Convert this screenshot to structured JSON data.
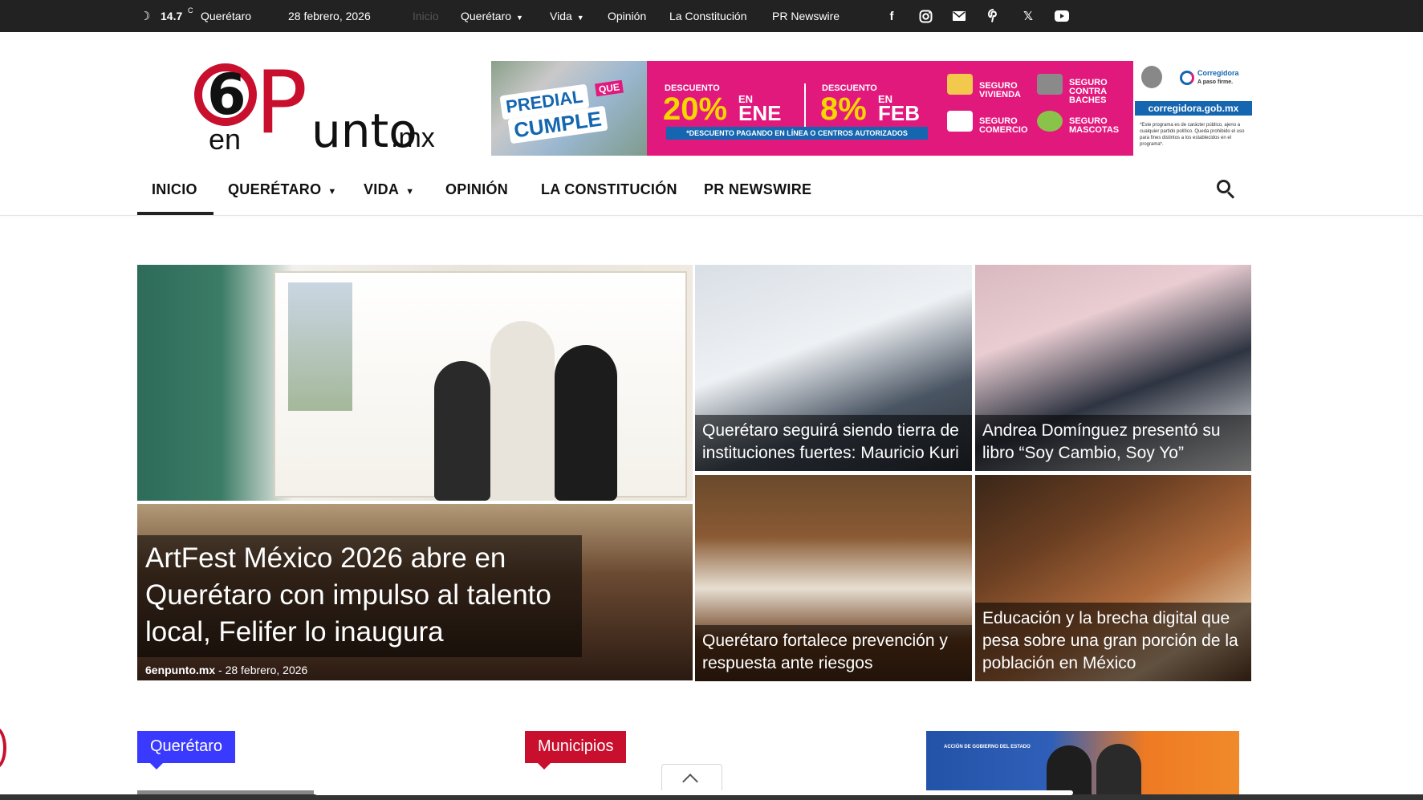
{
  "topbar": {
    "temperature": "14.7",
    "unit": "C",
    "city": "Querétaro",
    "date": "28 febrero, 2026",
    "nav": {
      "home": "Inicio",
      "queretaro": "Querétaro",
      "vida": "Vida",
      "opinion": "Opinión",
      "constitucion": "La Constitución",
      "prnewswire": "PR Newswire"
    },
    "social": [
      "facebook-icon",
      "instagram-icon",
      "mail-icon",
      "pinterest-icon",
      "x-icon",
      "youtube-icon"
    ]
  },
  "logo": {
    "six": "6",
    "en": "en",
    "p": "P",
    "unto": "unto",
    "mx": ".mx"
  },
  "banner": {
    "predial": "PREDIAL",
    "que": "QUE",
    "cumple": "CUMPLE",
    "descuento_label": "DESCUENTO",
    "ene_pct": "20%",
    "ene_en": "EN",
    "ene_month": "ENE",
    "feb_pct": "8%",
    "feb_en": "EN",
    "feb_month": "FEB",
    "strip": "*DESCUENTO PAGANDO EN LÍNEA O CENTROS AUTORIZADOS",
    "seguro_vivienda": "SEGURO VIVIENDA",
    "seguro_baches": "SEGURO CONTRA BACHES",
    "seguro_comercio": "SEGURO COMERCIO",
    "seguro_mascotas": "SEGURO MASCOTAS",
    "corregidora": "Corregidora",
    "corregidora_tag": "A paso firme.",
    "url": "corregidora.gob.mx",
    "note": "*Este programa es de carácter público, ajeno a cualquier partido político. Queda prohibido el uso para fines distintos a los establecidos en el programa*."
  },
  "mainnav": {
    "items": [
      "INICIO",
      "QUERÉTARO",
      "VIDA",
      "OPINIÓN",
      "LA CONSTITUCIÓN",
      "PR NEWSWIRE"
    ]
  },
  "featured": {
    "main": {
      "title": "ArtFest México 2026 abre en Querétaro con impulso al talento local, Felifer lo inaugura",
      "author": "6enpunto.mx",
      "separator": "-",
      "date": "28 febrero, 2026"
    },
    "tiles": [
      {
        "title": "Querétaro seguirá siendo tierra de instituciones fuertes: Mauricio Kuri"
      },
      {
        "title": "Andrea Domínguez presentó su libro “Soy Cambio, Soy Yo”"
      },
      {
        "title": "Querétaro fortalece prevención y respuesta ante riesgos"
      },
      {
        "title": "Educación y la brecha digital que pesa sobre una gran porción de la población en México"
      }
    ]
  },
  "sections": {
    "queretaro": "Querétaro",
    "municipios": "Municipios"
  },
  "side_ad": {
    "text": "ACCIÓN DE GOBIERNO DEL ESTADO"
  },
  "colors": {
    "topbar_bg": "#222222",
    "brand_red": "#c8102e",
    "banner_pink": "#e2197d",
    "banner_blue": "#1466b0",
    "banner_yellow": "#f6d600",
    "tag_blue": "#3a3aff"
  },
  "icons": {
    "weather": "moon-icon",
    "search": "search-icon",
    "scroll_top": "chevron-up-icon"
  }
}
